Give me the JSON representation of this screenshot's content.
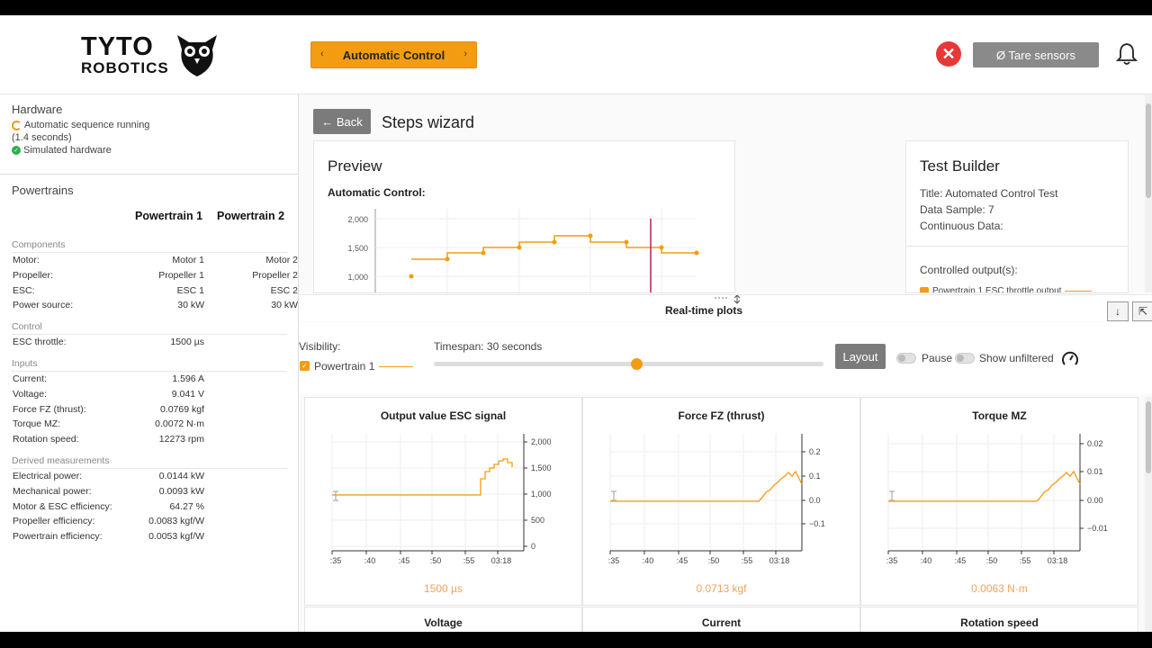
{
  "header": {
    "logo_line1": "TYTO",
    "logo_line2": "ROBOTICS",
    "mode_button": "Automatic Control",
    "tare_button": "Ø Tare sensors"
  },
  "sidebar": {
    "hardware_title": "Hardware",
    "status_running": "Automatic sequence running",
    "status_time": "(1.4 seconds)",
    "status_sim": "Simulated hardware",
    "powertrains_title": "Powertrains",
    "col1": "Powertrain 1",
    "col2": "Powertrain 2",
    "groups": {
      "components": "Components",
      "control": "Control",
      "inputs": "Inputs",
      "derived": "Derived measurements"
    },
    "components": [
      {
        "k": "Motor:",
        "v1": "Motor 1",
        "v2": "Motor 2"
      },
      {
        "k": "Propeller:",
        "v1": "Propeller 1",
        "v2": "Propeller 2"
      },
      {
        "k": "ESC:",
        "v1": "ESC 1",
        "v2": "ESC 2"
      },
      {
        "k": "Power source:",
        "v1": "30 kW",
        "v2": "30 kW"
      }
    ],
    "control": [
      {
        "k": "ESC throttle:",
        "v1": "1500 µs",
        "v2": ""
      }
    ],
    "inputs": [
      {
        "k": "Current:",
        "v1": "1.596 A",
        "v2": ""
      },
      {
        "k": "Voltage:",
        "v1": "9.041 V",
        "v2": ""
      },
      {
        "k": "Force FZ (thrust):",
        "v1": "0.0769 kgf",
        "v2": ""
      },
      {
        "k": "Torque MZ:",
        "v1": "0.0072 N·m",
        "v2": ""
      },
      {
        "k": "Rotation speed:",
        "v1": "12273 rpm",
        "v2": ""
      }
    ],
    "derived": [
      {
        "k": "Electrical power:",
        "v1": "0.0144 kW",
        "v2": ""
      },
      {
        "k": "Mechanical power:",
        "v1": "0.0093 kW",
        "v2": ""
      },
      {
        "k": "Motor & ESC efficiency:",
        "v1": "64.27 %",
        "v2": ""
      },
      {
        "k": "Propeller efficiency:",
        "v1": "0.0083 kgf/W",
        "v2": ""
      },
      {
        "k": "Powertrain efficiency:",
        "v1": "0.0053 kgf/W",
        "v2": ""
      }
    ]
  },
  "main": {
    "back_button": "← Back",
    "wizard_title": "Steps wizard",
    "preview_title": "Preview",
    "preview_sub": "Automatic Control:",
    "preview_yticks": [
      "2,000",
      "1,500",
      "1,000"
    ],
    "builder_title": "Test Builder",
    "builder_lines": [
      "Title: Automated Control Test",
      "Data Sample: 7",
      "Continuous Data:"
    ],
    "controlled_outputs": "Controlled output(s):",
    "controlled_item": "Powertrain 1 ESC throttle output",
    "realtime_title": "Real-time plots",
    "visibility_label": "Visibility:",
    "visibility_item": "Powertrain 1",
    "timespan_label": "Timespan: 30 seconds",
    "timespan_value": 0.52,
    "layout_button": "Layout",
    "pause_label": "Pause",
    "unfiltered_label": "Show unfiltered"
  },
  "plots": [
    {
      "title": "Output value ESC signal",
      "value": "1500 µs",
      "yticks": [
        "2,000",
        "1,500",
        "1,000",
        "500",
        "0"
      ]
    },
    {
      "title": "Force FZ (thrust)",
      "value": "0.0713 kgf",
      "yticks": [
        "0.2",
        "0.1",
        "0.0",
        "−0.1"
      ]
    },
    {
      "title": "Torque MZ",
      "value": "0.0063 N·m",
      "yticks": [
        "0.02",
        "0.01",
        "0.00",
        "−0.01"
      ]
    }
  ],
  "xticks": [
    ":35",
    ":40",
    ":45",
    ":50",
    ":55",
    "03:18"
  ],
  "plots_row2": [
    "Voltage",
    "Current",
    "Rotation speed"
  ],
  "colors": {
    "accent": "#f39c12",
    "danger": "#e53935",
    "marker": "#c2185b"
  }
}
